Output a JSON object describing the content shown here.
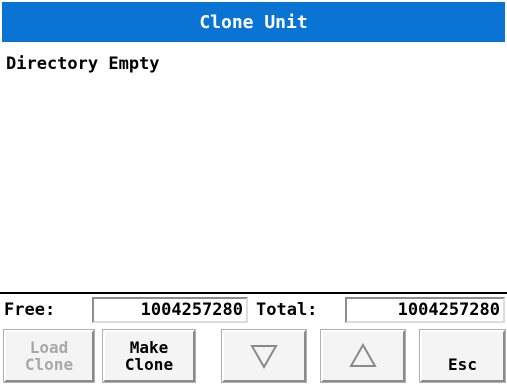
{
  "title": "Clone Unit",
  "list": {
    "empty_text": "Directory Empty"
  },
  "status": {
    "free_label": "Free:",
    "free_value": "1004257280",
    "total_label": "Total:",
    "total_value": "1004257280"
  },
  "buttons": {
    "load_clone": "Load\nClone",
    "make_clone": "Make\nClone",
    "down_icon": "triangle-down-icon",
    "up_icon": "triangle-up-icon",
    "esc": "Esc"
  }
}
